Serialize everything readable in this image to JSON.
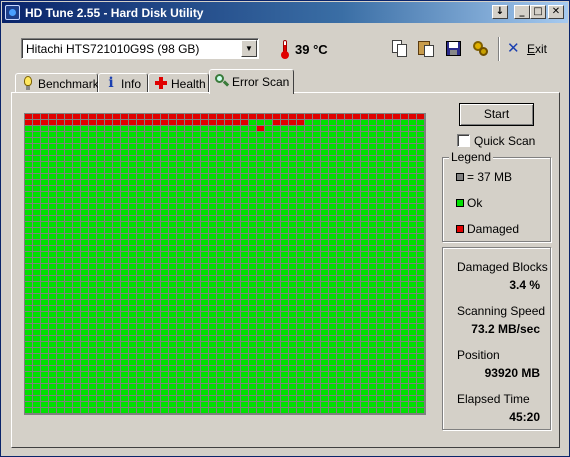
{
  "window": {
    "title": "HD Tune 2.55 - Hard Disk Utility",
    "controls": [
      "↓",
      "_",
      "□",
      "✕"
    ]
  },
  "toolbar": {
    "drive": "Hitachi HTS721010G9S (98 GB)",
    "temperature": "39 °C",
    "exit_label_underlined": "E",
    "exit_label_rest": "xit",
    "icons": [
      "copy-info-icon",
      "copy-screen-icon",
      "save-icon",
      "options-icon",
      "exit-icon"
    ]
  },
  "tabs": [
    {
      "label": "Benchmark",
      "icon": "benchmark-icon",
      "active": false
    },
    {
      "label": "Info",
      "icon": "info-icon",
      "active": false
    },
    {
      "label": "Health",
      "icon": "health-icon",
      "active": false
    },
    {
      "label": "Error Scan",
      "icon": "error-scan-icon",
      "active": true
    }
  ],
  "scan": {
    "start_label": "Start",
    "quick_scan_label": "Quick Scan",
    "quick_scan_checked": false,
    "grid": {
      "columns": 50,
      "rows": 50,
      "damaged_first_row": true,
      "damaged_row2_columns": [
        0,
        1,
        2,
        3,
        4,
        5,
        6,
        7,
        8,
        9,
        10,
        11,
        12,
        13,
        14,
        15,
        16,
        17,
        18,
        19,
        20,
        21,
        22,
        23,
        24,
        25,
        26,
        27,
        31,
        32,
        33,
        34
      ],
      "damaged_row3_columns": [
        29
      ],
      "ok_color": "#00e000",
      "damaged_color": "#e00000",
      "block_color": "#808080"
    }
  },
  "legend": {
    "title": "Legend",
    "items": [
      {
        "label": "= 37 MB",
        "color": "#808080"
      },
      {
        "label": "Ok",
        "color": "#00e000"
      },
      {
        "label": "Damaged",
        "color": "#e00000"
      }
    ]
  },
  "stats": [
    {
      "label": "Damaged Blocks",
      "value": "3.4 %"
    },
    {
      "label": "Scanning Speed",
      "value": "73.2 MB/sec"
    },
    {
      "label": "Position",
      "value": "93920 MB"
    },
    {
      "label": "Elapsed Time",
      "value": "45:20"
    }
  ]
}
